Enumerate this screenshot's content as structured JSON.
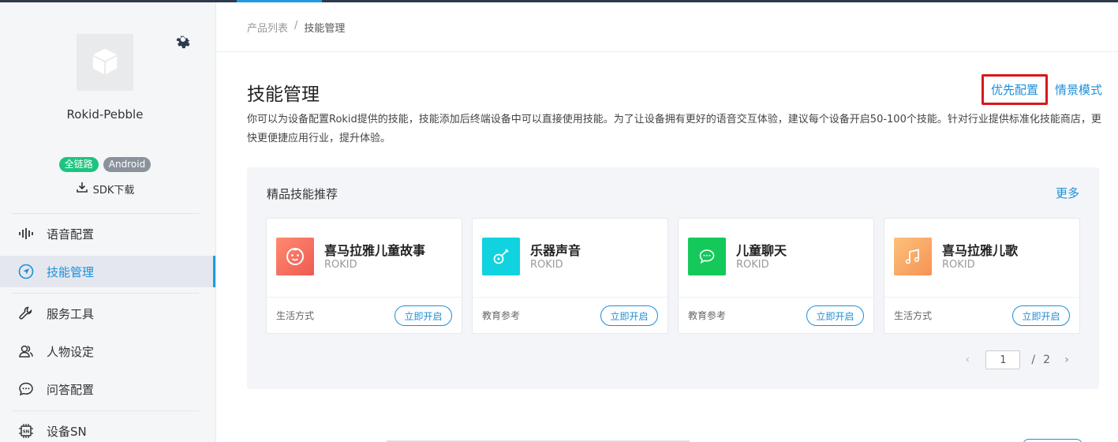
{
  "sidebar": {
    "product_name": "Rokid-Pebble",
    "badges": [
      "全链路",
      "Android"
    ],
    "sdk_label": "SDK下载",
    "nav": [
      {
        "label": "语音配置",
        "icon": "voice-wave-icon"
      },
      {
        "label": "技能管理",
        "icon": "navigation-arrow-icon"
      },
      {
        "label": "服务工具",
        "icon": "wrench-icon"
      },
      {
        "label": "人物设定",
        "icon": "users-icon"
      },
      {
        "label": "问答配置",
        "icon": "chat-bubble-icon"
      },
      {
        "label": "设备SN",
        "icon": "chip-sn-icon"
      }
    ]
  },
  "breadcrumb": {
    "parent": "产品列表",
    "separator": "/",
    "current": "技能管理"
  },
  "header": {
    "title": "技能管理",
    "priority_label": "优先配置",
    "scene_label": "情景模式",
    "description": "你可以为设备配置Rokid提供的技能，技能添加后终端设备中可以直接使用技能。为了让设备拥有更好的语音交互体验，建议每个设备开启50-100个技能。针对行业提供标准化技能商店，更快更便捷应用行业，提升体验。"
  },
  "recommend": {
    "title": "精品技能推荐",
    "more_label": "更多",
    "cards": [
      {
        "name": "喜马拉雅儿童故事",
        "org": "ROKID",
        "category": "生活方式",
        "button": "立即开启",
        "icon": "baby-face-icon",
        "color": "#f46a5c"
      },
      {
        "name": "乐器声音",
        "org": "ROKID",
        "category": "教育参考",
        "button": "立即开启",
        "icon": "guitar-icon",
        "color": "#10d3df"
      },
      {
        "name": "儿童聊天",
        "org": "ROKID",
        "category": "教育参考",
        "button": "立即开启",
        "icon": "chat-icon",
        "color": "#14c95a"
      },
      {
        "name": "喜马拉雅儿歌",
        "org": "ROKID",
        "category": "生活方式",
        "button": "立即开启",
        "icon": "music-note-icon",
        "color": "#f9a465"
      }
    ],
    "pager": {
      "current": "1",
      "separator": "/",
      "total": "2"
    }
  },
  "colors": {
    "accent": "#1e8fd9",
    "highlight_border": "#d9171b",
    "badge_green": "#1dc47f"
  }
}
